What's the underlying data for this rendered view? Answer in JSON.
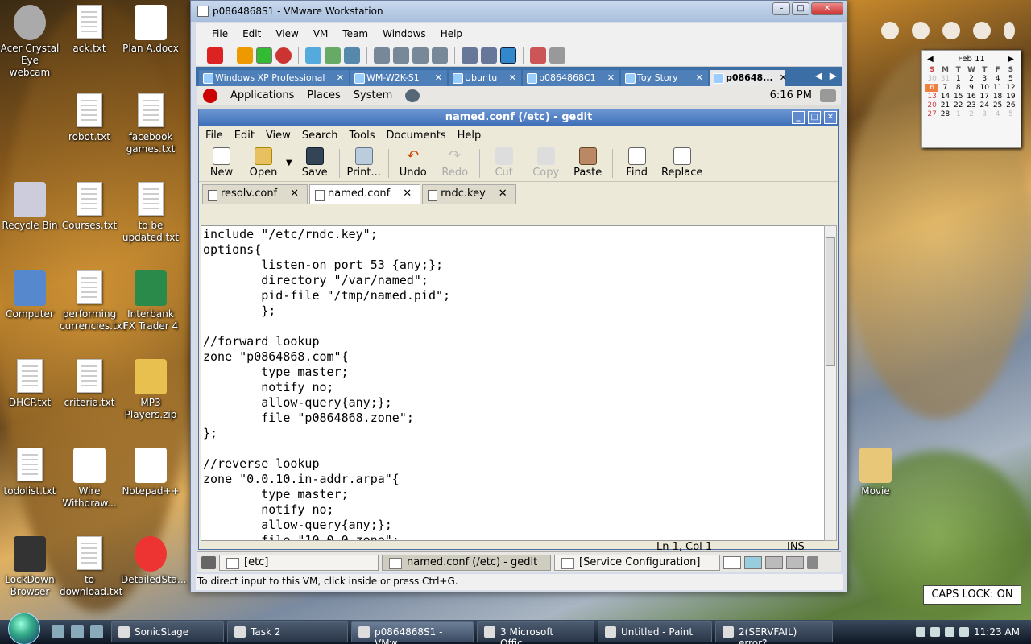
{
  "desktop_icons": [
    {
      "label": "Acer Crystal Eye webcam",
      "icon": "webcam-icon",
      "col": 0,
      "row": 0
    },
    {
      "label": "ack.txt",
      "icon": "text-file-icon"
    },
    {
      "label": "Plan A.docx",
      "icon": "word-doc-icon"
    },
    {
      "label": "robot.txt",
      "icon": "text-file-icon"
    },
    {
      "label": "facebook games.txt",
      "icon": "text-file-icon"
    },
    {
      "label": "Recycle Bin",
      "icon": "recycle-bin-icon"
    },
    {
      "label": "Courses.txt",
      "icon": "text-file-icon"
    },
    {
      "label": "to be updated.txt",
      "icon": "text-file-icon"
    },
    {
      "label": "Computer",
      "icon": "computer-icon"
    },
    {
      "label": "performing currencies.txt",
      "icon": "text-file-icon"
    },
    {
      "label": "Interbank FX Trader 4",
      "icon": "app-shortcut-icon"
    },
    {
      "label": "DHCP.txt",
      "icon": "text-file-icon"
    },
    {
      "label": "criteria.txt",
      "icon": "text-file-icon"
    },
    {
      "label": "MP3 Players.zip",
      "icon": "zip-folder-icon"
    },
    {
      "label": "todolist.txt",
      "icon": "text-file-icon"
    },
    {
      "label": "Wire Withdraw...",
      "icon": "pdf-icon"
    },
    {
      "label": "Notepad++",
      "icon": "notepadpp-icon"
    },
    {
      "label": "LockDown Browser",
      "icon": "lock-icon"
    },
    {
      "label": "to download.txt",
      "icon": "text-file-icon"
    },
    {
      "label": "DetailedSta...",
      "icon": "chrome-icon"
    },
    {
      "label": "Movie",
      "icon": "folder-icon"
    }
  ],
  "vmware": {
    "title": "p0864868S1 - VMware Workstation",
    "menu": [
      "File",
      "Edit",
      "View",
      "VM",
      "Team",
      "Windows",
      "Help"
    ],
    "tabs": [
      "Windows XP Professional",
      "WM-W2K-S1",
      "Ubuntu",
      "p0864868C1",
      "Toy Story",
      "p08648..."
    ],
    "status": "To direct input to this VM, click inside or press Ctrl+G."
  },
  "guest": {
    "panel": {
      "applications": "Applications",
      "places": "Places",
      "system": "System",
      "clock": "6:16 PM"
    },
    "gedit": {
      "title": "named.conf (/etc) - gedit",
      "menu": [
        "File",
        "Edit",
        "View",
        "Search",
        "Tools",
        "Documents",
        "Help"
      ],
      "toolbar": [
        "New",
        "Open",
        "Save",
        "Print...",
        "Undo",
        "Redo",
        "Cut",
        "Copy",
        "Paste",
        "Find",
        "Replace"
      ],
      "tabs": [
        "resolv.conf",
        "named.conf",
        "rndc.key"
      ],
      "code": "include \"/etc/rndc.key\";\noptions{\n        listen-on port 53 {any;};\n        directory \"/var/named\";\n        pid-file \"/tmp/named.pid\";\n        };\n\n//forward lookup\nzone \"p0864868.com\"{\n        type master;\n        notify no;\n        allow-query{any;};\n        file \"p0864868.zone\";\n};\n\n//reverse lookup\nzone \"0.0.10.in-addr.arpa\"{\n        type master;\n        notify no;\n        allow-query{any;};\n        file \"10.0.0.zone\";",
      "status_pos": "Ln 1, Col 1",
      "status_mode": "INS"
    },
    "taskbar": [
      "[etc]",
      "named.conf (/etc) - gedit",
      "[Service Configuration]"
    ]
  },
  "calendar": {
    "month": "Feb 11",
    "dow": [
      "S",
      "M",
      "T",
      "W",
      "T",
      "F",
      "S"
    ],
    "weeks": [
      [
        "30",
        "31",
        "1",
        "2",
        "3",
        "4",
        "5"
      ],
      [
        "6",
        "7",
        "8",
        "9",
        "10",
        "11",
        "12"
      ],
      [
        "13",
        "14",
        "15",
        "16",
        "17",
        "18",
        "19"
      ],
      [
        "20",
        "21",
        "22",
        "23",
        "24",
        "25",
        "26"
      ],
      [
        "27",
        "28",
        "1",
        "2",
        "3",
        "4",
        "5"
      ]
    ],
    "today": "6"
  },
  "capslock": "CAPS LOCK: ON",
  "taskbar": {
    "items": [
      "SonicStage",
      "Task 2",
      "p0864868S1 - VMw...",
      "3 Microsoft Offic...",
      "Untitled - Paint",
      "2(SERVFAIL) error? ..."
    ],
    "clock": "11:23 AM"
  },
  "colors": {
    "vm_tabs_bg": "#3a6ea5",
    "gedit_title": "#3f6fb8",
    "today": "#f08040"
  }
}
